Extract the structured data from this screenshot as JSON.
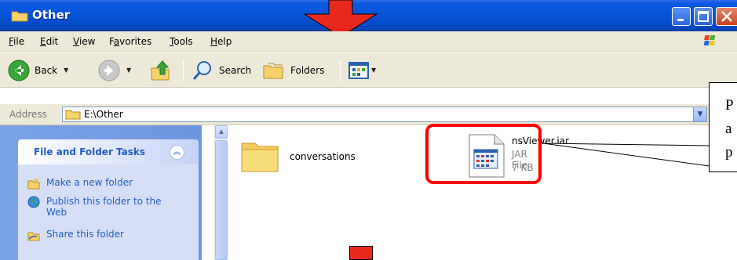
{
  "window": {
    "title": "Other"
  },
  "menu": {
    "items": [
      {
        "label": "File",
        "underline": "F",
        "rest": "ile"
      },
      {
        "label": "Edit",
        "underline": "E",
        "rest": "dit"
      },
      {
        "label": "View",
        "underline": "V",
        "rest": "iew"
      },
      {
        "label": "Favorites",
        "pre": "F",
        "underline": "a",
        "rest": "vorites"
      },
      {
        "label": "Tools",
        "underline": "T",
        "rest": "ools"
      },
      {
        "label": "Help",
        "underline": "H",
        "rest": "elp"
      }
    ]
  },
  "toolbar": {
    "back_label": "Back",
    "search_label": "Search",
    "folders_label": "Folders"
  },
  "address": {
    "label": "Address",
    "value": "E:\\Other"
  },
  "tasks": {
    "title": "File and Folder Tasks",
    "items": [
      {
        "label": "Make a new folder",
        "icon": "new-folder-icon"
      },
      {
        "label": "Publish this folder to the Web",
        "icon": "globe-icon"
      },
      {
        "label": "Share this folder",
        "icon": "share-folder-icon"
      }
    ]
  },
  "files": [
    {
      "name": "conversations",
      "type": "folder"
    },
    {
      "name": "nsViewer.jar",
      "type_label": "JAR File",
      "size": "7 KB"
    }
  ],
  "callout": {
    "text": "P\na\np"
  },
  "colors": {
    "title_bar": "#0554d6",
    "highlight": "#ff0000",
    "task_text": "#215dc6",
    "arrow": "#e8281e"
  }
}
